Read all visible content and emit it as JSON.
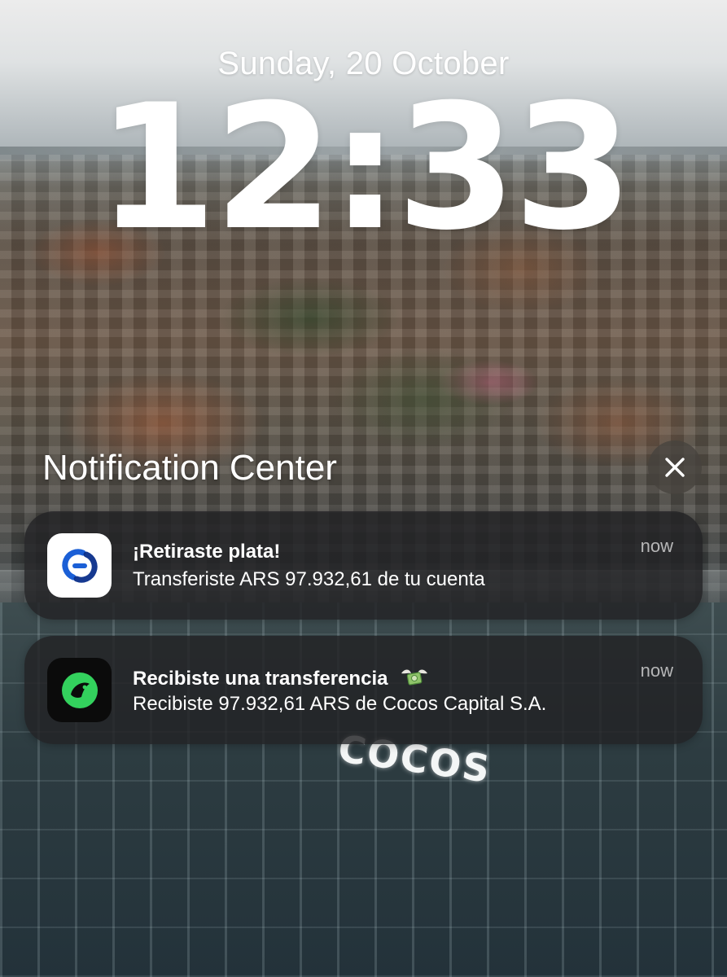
{
  "lock_screen": {
    "date": "Sunday, 20 October",
    "time": "12:33"
  },
  "wallpaper": {
    "sign_text": "COCOS"
  },
  "notification_center": {
    "title": "Notification Center",
    "close_icon": "close-icon",
    "notifications": [
      {
        "app_icon": "transfer-app-icon",
        "title": "¡Retiraste plata!",
        "body": "Transferiste ARS 97.932,61 de tu cuenta",
        "time": "now",
        "icon_accent": "#1b5fd6"
      },
      {
        "app_icon": "cocos-app-icon",
        "title": "Recibiste una transferencia",
        "title_emoji": "money-with-wings",
        "body": "Recibiste 97.932,61 ARS de Cocos Capital S.A.",
        "time": "now",
        "icon_accent": "#33d15d"
      }
    ]
  }
}
